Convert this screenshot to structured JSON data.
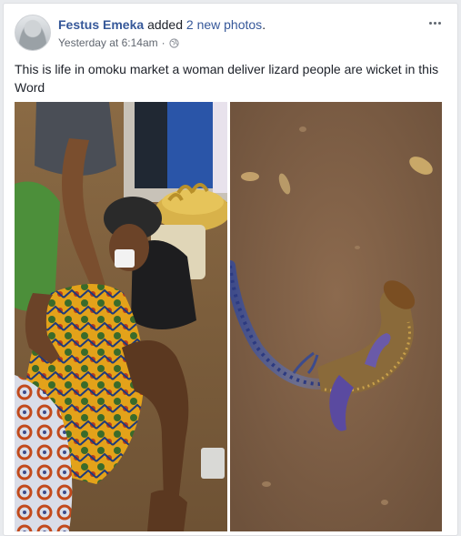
{
  "post": {
    "author": "Festus Emeka",
    "action_prefix": "added",
    "action_link": "2 new photos",
    "action_suffix": ".",
    "time": "Yesterday at 6:14am",
    "separator": "·",
    "privacy_icon": "globe-icon",
    "more_icon": "more-options-icon",
    "text": "This is life in omoku market a woman deliver lizard people are wicket in this Word",
    "photos": [
      {
        "name": "market-woman-photo"
      },
      {
        "name": "lizard-photo"
      }
    ]
  },
  "colors": {
    "link": "#365899",
    "text": "#1d2129",
    "meta": "#616770",
    "background": "#e9ebee"
  }
}
